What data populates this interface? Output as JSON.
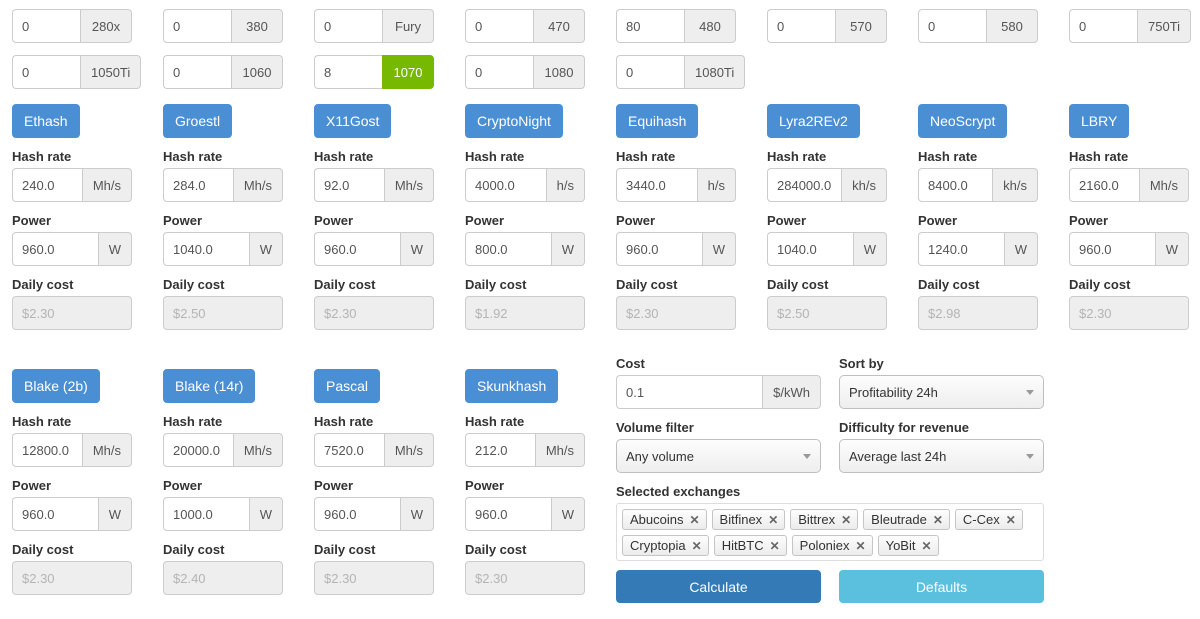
{
  "gpus": [
    {
      "count": "0",
      "model": "280x",
      "highlighted": false
    },
    {
      "count": "0",
      "model": "380",
      "highlighted": false
    },
    {
      "count": "0",
      "model": "Fury",
      "highlighted": false
    },
    {
      "count": "0",
      "model": "470",
      "highlighted": false
    },
    {
      "count": "80",
      "model": "480",
      "highlighted": false
    },
    {
      "count": "0",
      "model": "570",
      "highlighted": false
    },
    {
      "count": "0",
      "model": "580",
      "highlighted": false
    },
    {
      "count": "0",
      "model": "750Ti",
      "highlighted": false
    },
    {
      "count": "0",
      "model": "1050Ti",
      "highlighted": false
    },
    {
      "count": "0",
      "model": "1060",
      "highlighted": false
    },
    {
      "count": "8",
      "model": "1070",
      "highlighted": true
    },
    {
      "count": "0",
      "model": "1080",
      "highlighted": false
    },
    {
      "count": "0",
      "model": "1080Ti",
      "highlighted": false
    }
  ],
  "labels": {
    "hash_rate": "Hash rate",
    "power": "Power",
    "daily_cost": "Daily cost",
    "cost": "Cost",
    "sort_by": "Sort by",
    "volume_filter": "Volume filter",
    "difficulty": "Difficulty for revenue",
    "selected_exchanges": "Selected exchanges"
  },
  "algorithms": [
    {
      "name": "Ethash",
      "hashrate": "240.0",
      "hash_unit": "Mh/s",
      "power": "960.0",
      "power_unit": "W",
      "daily_cost": "$2.30"
    },
    {
      "name": "Groestl",
      "hashrate": "284.0",
      "hash_unit": "Mh/s",
      "power": "1040.0",
      "power_unit": "W",
      "daily_cost": "$2.50"
    },
    {
      "name": "X11Gost",
      "hashrate": "92.0",
      "hash_unit": "Mh/s",
      "power": "960.0",
      "power_unit": "W",
      "daily_cost": "$2.30"
    },
    {
      "name": "CryptoNight",
      "hashrate": "4000.0",
      "hash_unit": "h/s",
      "power": "800.0",
      "power_unit": "W",
      "daily_cost": "$1.92"
    },
    {
      "name": "Equihash",
      "hashrate": "3440.0",
      "hash_unit": "h/s",
      "power": "960.0",
      "power_unit": "W",
      "daily_cost": "$2.30"
    },
    {
      "name": "Lyra2REv2",
      "hashrate": "284000.0",
      "hash_unit": "kh/s",
      "power": "1040.0",
      "power_unit": "W",
      "daily_cost": "$2.50"
    },
    {
      "name": "NeoScrypt",
      "hashrate": "8400.0",
      "hash_unit": "kh/s",
      "power": "1240.0",
      "power_unit": "W",
      "daily_cost": "$2.98"
    },
    {
      "name": "LBRY",
      "hashrate": "2160.0",
      "hash_unit": "Mh/s",
      "power": "960.0",
      "power_unit": "W",
      "daily_cost": "$2.30"
    },
    {
      "name": "Blake (2b)",
      "hashrate": "12800.0",
      "hash_unit": "Mh/s",
      "power": "960.0",
      "power_unit": "W",
      "daily_cost": "$2.30"
    },
    {
      "name": "Blake (14r)",
      "hashrate": "20000.0",
      "hash_unit": "Mh/s",
      "power": "1000.0",
      "power_unit": "W",
      "daily_cost": "$2.40"
    },
    {
      "name": "Pascal",
      "hashrate": "7520.0",
      "hash_unit": "Mh/s",
      "power": "960.0",
      "power_unit": "W",
      "daily_cost": "$2.30"
    },
    {
      "name": "Skunkhash",
      "hashrate": "212.0",
      "hash_unit": "Mh/s",
      "power": "960.0",
      "power_unit": "W",
      "daily_cost": "$2.30"
    }
  ],
  "settings": {
    "cost_value": "0.1",
    "cost_unit": "$/kWh",
    "sort_by_value": "Profitability 24h",
    "volume_filter_value": "Any volume",
    "difficulty_value": "Average last 24h"
  },
  "exchanges": [
    "Abucoins",
    "Bitfinex",
    "Bittrex",
    "Bleutrade",
    "C-Cex",
    "Cryptopia",
    "HitBTC",
    "Poloniex",
    "YoBit"
  ],
  "exchange_remove_glyph": "✕",
  "buttons": {
    "calculate": "Calculate",
    "defaults": "Defaults"
  },
  "colors": {
    "algo_button": "#4a8fd4",
    "highlight_green": "#76b900",
    "calculate": "#337ab7",
    "defaults": "#5bc0de"
  }
}
